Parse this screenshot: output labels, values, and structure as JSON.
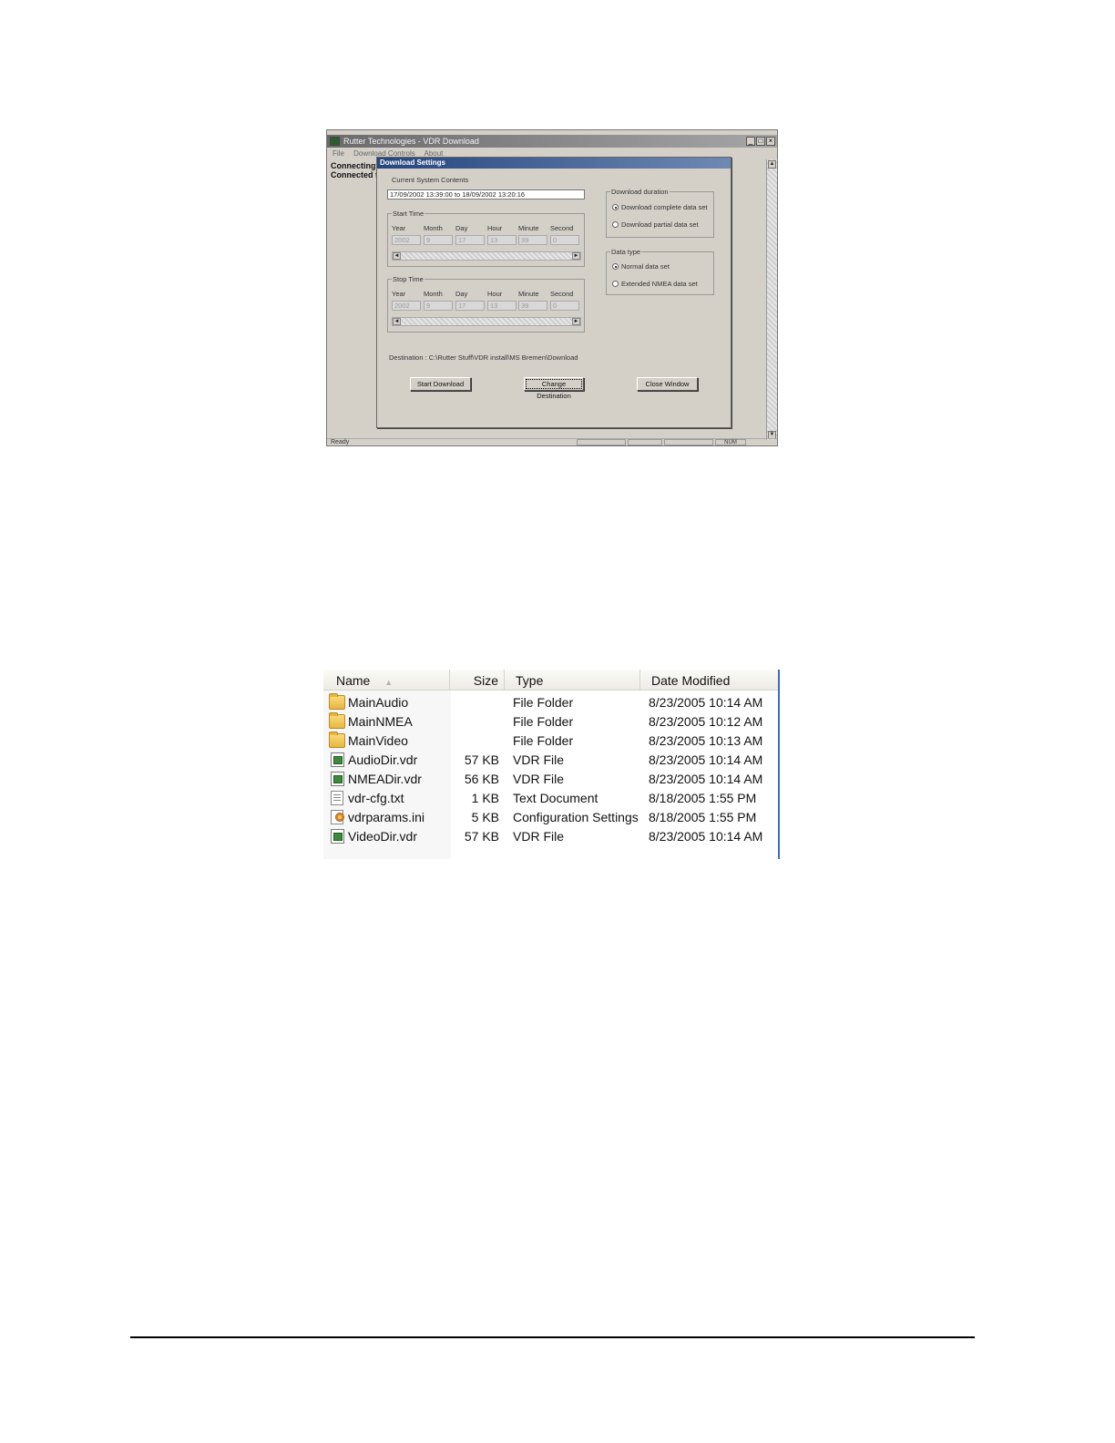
{
  "app": {
    "title": "Rutter Technologies - VDR Download",
    "window_controls": {
      "minimize": "_",
      "maximize": "□",
      "close": "×"
    },
    "menu": [
      "File",
      "Download Controls",
      "About"
    ],
    "status_lines": [
      "Connecting",
      "Connected t"
    ],
    "statusbar": {
      "text": "Ready",
      "num": "NUM"
    }
  },
  "dialog": {
    "title": "Download Settings",
    "current_contents_label": "Current System Contents",
    "current_contents_value": "17/09/2002 13:39:00  to  18/09/2002 13:20:16",
    "start_time": {
      "legend": "Start Time",
      "columns": [
        "Year",
        "Month",
        "Day",
        "Hour",
        "Minute",
        "Second"
      ],
      "values": [
        "2002",
        "9",
        "17",
        "13",
        "39",
        "0"
      ]
    },
    "stop_time": {
      "legend": "Stop Time",
      "columns": [
        "Year",
        "Month",
        "Day",
        "Hour",
        "Minute",
        "Second"
      ],
      "values": [
        "2002",
        "9",
        "17",
        "13",
        "39",
        "0"
      ]
    },
    "download_duration": {
      "legend": "Download duration",
      "options": [
        "Download complete data set",
        "Download partial data set"
      ],
      "selected_index": 0
    },
    "data_type": {
      "legend": "Data type",
      "options": [
        "Normal data set",
        "Extended NMEA data set"
      ],
      "selected_index": 0
    },
    "destination": "Destination :  C:\\Rutter Stuff\\VDR install\\MS Bremen\\Download",
    "buttons": {
      "start_download": "Start Download",
      "change_destination": "Change Destination",
      "close_window": "Close Window"
    }
  },
  "explorer": {
    "columns": {
      "name": "Name",
      "size": "Size",
      "type": "Type",
      "date_modified": "Date Modified"
    },
    "files": [
      {
        "name": "MainAudio",
        "size": "",
        "type": "File Folder",
        "date": "8/23/2005 10:14 AM",
        "icon": "folder-icon"
      },
      {
        "name": "MainNMEA",
        "size": "",
        "type": "File Folder",
        "date": "8/23/2005 10:12 AM",
        "icon": "folder-icon"
      },
      {
        "name": "MainVideo",
        "size": "",
        "type": "File Folder",
        "date": "8/23/2005 10:13 AM",
        "icon": "folder-icon"
      },
      {
        "name": "AudioDir.vdr",
        "size": "57 KB",
        "type": "VDR File",
        "date": "8/23/2005 10:14 AM",
        "icon": "vdr-file-icon"
      },
      {
        "name": "NMEADir.vdr",
        "size": "56 KB",
        "type": "VDR File",
        "date": "8/23/2005 10:14 AM",
        "icon": "vdr-file-icon"
      },
      {
        "name": "vdr-cfg.txt",
        "size": "1 KB",
        "type": "Text Document",
        "date": "8/18/2005 1:55 PM",
        "icon": "text-file-icon"
      },
      {
        "name": "vdrparams.ini",
        "size": "5 KB",
        "type": "Configuration Settings",
        "date": "8/18/2005 1:55 PM",
        "icon": "config-file-icon"
      },
      {
        "name": "VideoDir.vdr",
        "size": "57 KB",
        "type": "VDR File",
        "date": "8/23/2005 10:14 AM",
        "icon": "vdr-file-icon"
      }
    ]
  }
}
